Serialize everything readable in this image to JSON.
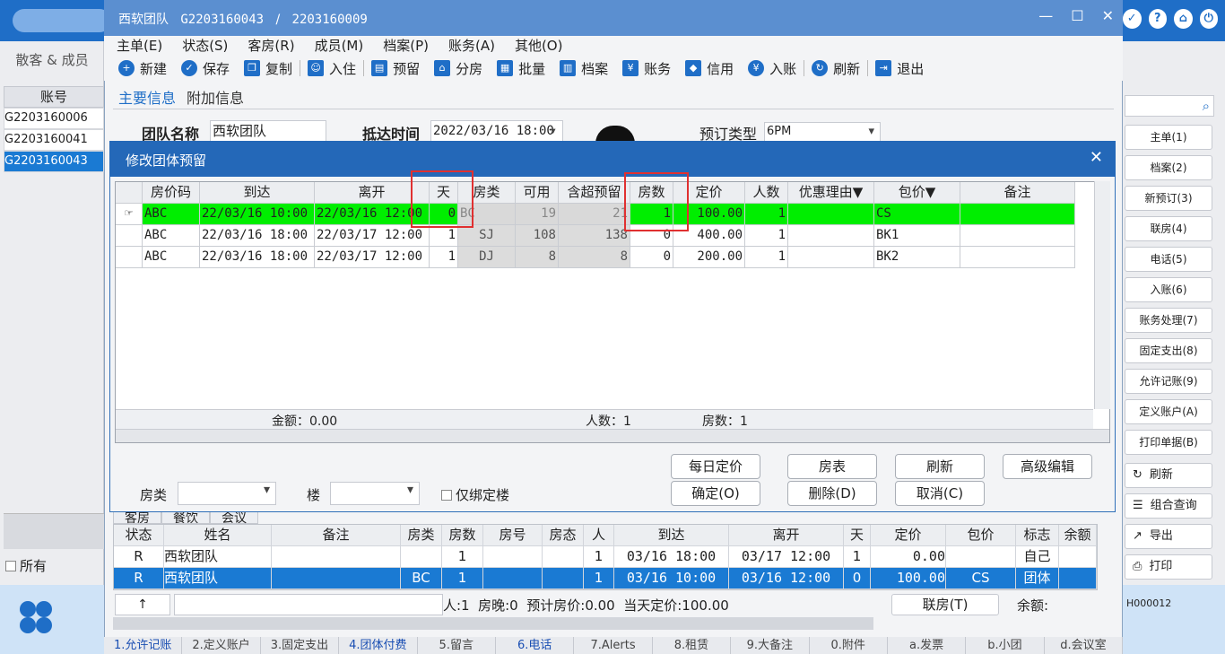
{
  "window": {
    "title": "西软团队",
    "code1": "G2203160043",
    "sep": "/",
    "code2": "2203160009",
    "min": "—",
    "max": "☐",
    "close": "✕"
  },
  "menu": [
    "主单(E)",
    "状态(S)",
    "客房(R)",
    "成员(M)",
    "档案(P)",
    "账务(A)",
    "其他(O)"
  ],
  "toolbar": [
    "新建",
    "保存",
    "复制",
    "入住",
    "预留",
    "分房",
    "批量",
    "档案",
    "账务",
    "信用",
    "入账",
    "刷新",
    "退出"
  ],
  "tabs": {
    "main": "主要信息",
    "extra": "附加信息"
  },
  "form": {
    "group_label": "团队名称",
    "group_value": "西软团队",
    "arrival_label": "抵达时间",
    "arrival_value": "2022/03/16 18:00",
    "type_label": "预订类型",
    "type_value": "6PM"
  },
  "left": {
    "title": "散客 & 成员",
    "header": "账号",
    "rows": [
      "G2203160006",
      "G2203160041",
      "G2203160043"
    ],
    "all_label": "所有"
  },
  "right": {
    "buttons": [
      "主单(1)",
      "档案(2)",
      "新预订(3)",
      "联房(4)",
      "电话(5)",
      "入账(6)",
      "账务处理(7)",
      "固定支出(8)",
      "允许记账(9)",
      "定义账户(A)",
      "打印单据(B)"
    ],
    "buttons2": [
      "刷新",
      "组合查询",
      "导出",
      "打印"
    ],
    "code": "H000012"
  },
  "dialog": {
    "title": "修改团体预留",
    "close": "✕",
    "headers": [
      "房价码",
      "到达",
      "离开",
      "天",
      "房类",
      "可用",
      "含超预留",
      "房数",
      "定价",
      "人数",
      "优惠理由▼",
      "包价▼",
      "备注"
    ],
    "rows": [
      [
        "ABC",
        "22/03/16 10:00",
        "22/03/16 12:00",
        "0",
        "BC",
        "19",
        "21",
        "1",
        "100.00",
        "1",
        "",
        "CS",
        ""
      ],
      [
        "ABC",
        "22/03/16 18:00",
        "22/03/17 12:00",
        "1",
        "SJ",
        "108",
        "138",
        "0",
        "400.00",
        "1",
        "",
        "BK1",
        ""
      ],
      [
        "ABC",
        "22/03/16 18:00",
        "22/03/17 12:00",
        "1",
        "DJ",
        "8",
        "8",
        "0",
        "200.00",
        "1",
        "",
        "BK2",
        ""
      ]
    ],
    "footer_amount": "金额：0.00",
    "footer_people": "人数：1",
    "footer_rooms": "房数：1",
    "buttons_top": [
      "每日定价",
      "房表",
      "刷新",
      "高级编辑"
    ],
    "buttons_bottom": [
      "确定(O)",
      "删除(D)",
      "取消(C)"
    ],
    "roomtype_label": "房类",
    "building_label": "楼",
    "only_building": "仅绑定楼"
  },
  "lower": {
    "tabs": [
      "客房",
      "餐饮",
      "会议"
    ],
    "headers": [
      "状态",
      "姓名",
      "备注",
      "房类",
      "房数",
      "房号",
      "房态",
      "人",
      "到达",
      "离开",
      "天",
      "定价",
      "包价",
      "标志",
      "余额"
    ],
    "rows": [
      [
        "R",
        "西软团队",
        "",
        "",
        "1",
        "",
        "",
        "1",
        "03/16 18:00",
        "03/17 12:00",
        "1",
        "0.00",
        "",
        "自己",
        ""
      ],
      [
        "R",
        "西软团队",
        "",
        "BC",
        "1",
        "",
        "",
        "1",
        "03/16 10:00",
        "03/16 12:00",
        "0",
        "100.00",
        "CS",
        "团体",
        ""
      ]
    ],
    "up": "↑",
    "stats": "人:1  房晚:0  预计房价:0.00  当天定价:100.00",
    "link_btn": "联房(T)",
    "balance": "余额:"
  },
  "bottom_tabs": [
    "1.允许记账",
    "2.定义账户",
    "3.固定支出",
    "4.团体付费",
    "5.留言",
    "6.电话",
    "7.Alerts",
    "8.租赁",
    "9.大备注",
    "0.附件",
    "a.发票",
    "b.小团",
    "d.会议室"
  ]
}
